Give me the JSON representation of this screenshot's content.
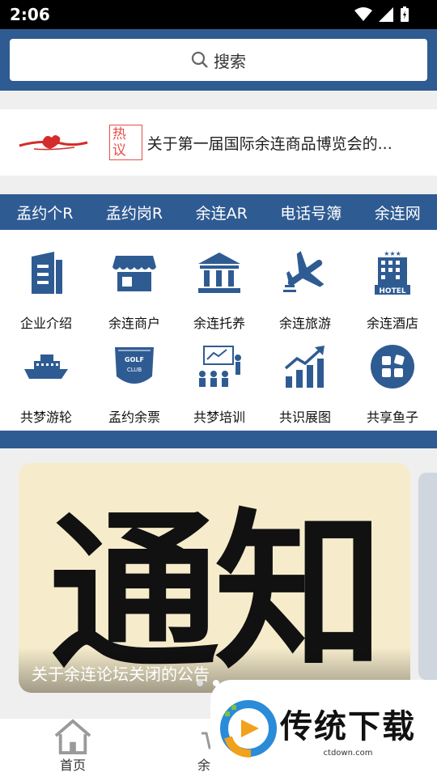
{
  "status": {
    "time": "2:06"
  },
  "search": {
    "label": "搜索"
  },
  "ticker": {
    "tag": "热议",
    "text": "关于第一届国际余连商品博览会的..."
  },
  "nav": [
    "孟约个R",
    "孟约岗R",
    "余连AR",
    "电话号簿",
    "余连网"
  ],
  "grid": [
    {
      "label": "企业介绍",
      "icon": "building-icon"
    },
    {
      "label": "余连商户",
      "icon": "shop-icon"
    },
    {
      "label": "余连托养",
      "icon": "bank-icon"
    },
    {
      "label": "余连旅游",
      "icon": "airplane-icon"
    },
    {
      "label": "余连酒店",
      "icon": "hotel-icon"
    },
    {
      "label": "共梦游轮",
      "icon": "cruise-ship-icon"
    },
    {
      "label": "孟约余票",
      "icon": "golf-club-icon"
    },
    {
      "label": "共梦培训",
      "icon": "training-icon"
    },
    {
      "label": "共识展图",
      "icon": "bar-chart-icon"
    },
    {
      "label": "共享鱼子",
      "icon": "apps-icon"
    }
  ],
  "banner": {
    "big_text": "通知",
    "caption": "关于余连论坛关闭的公告"
  },
  "hotel_sign": "HOTEL",
  "golf_sign_top": "GOLF",
  "golf_sign_bottom": "CLUB",
  "tabs": [
    {
      "label": "首页"
    },
    {
      "label": "余连"
    }
  ],
  "watermark": {
    "title": "传统下载",
    "url": "ctdown.com"
  },
  "colors": {
    "primary": "#2f5b93",
    "hot": "#e2514b"
  }
}
